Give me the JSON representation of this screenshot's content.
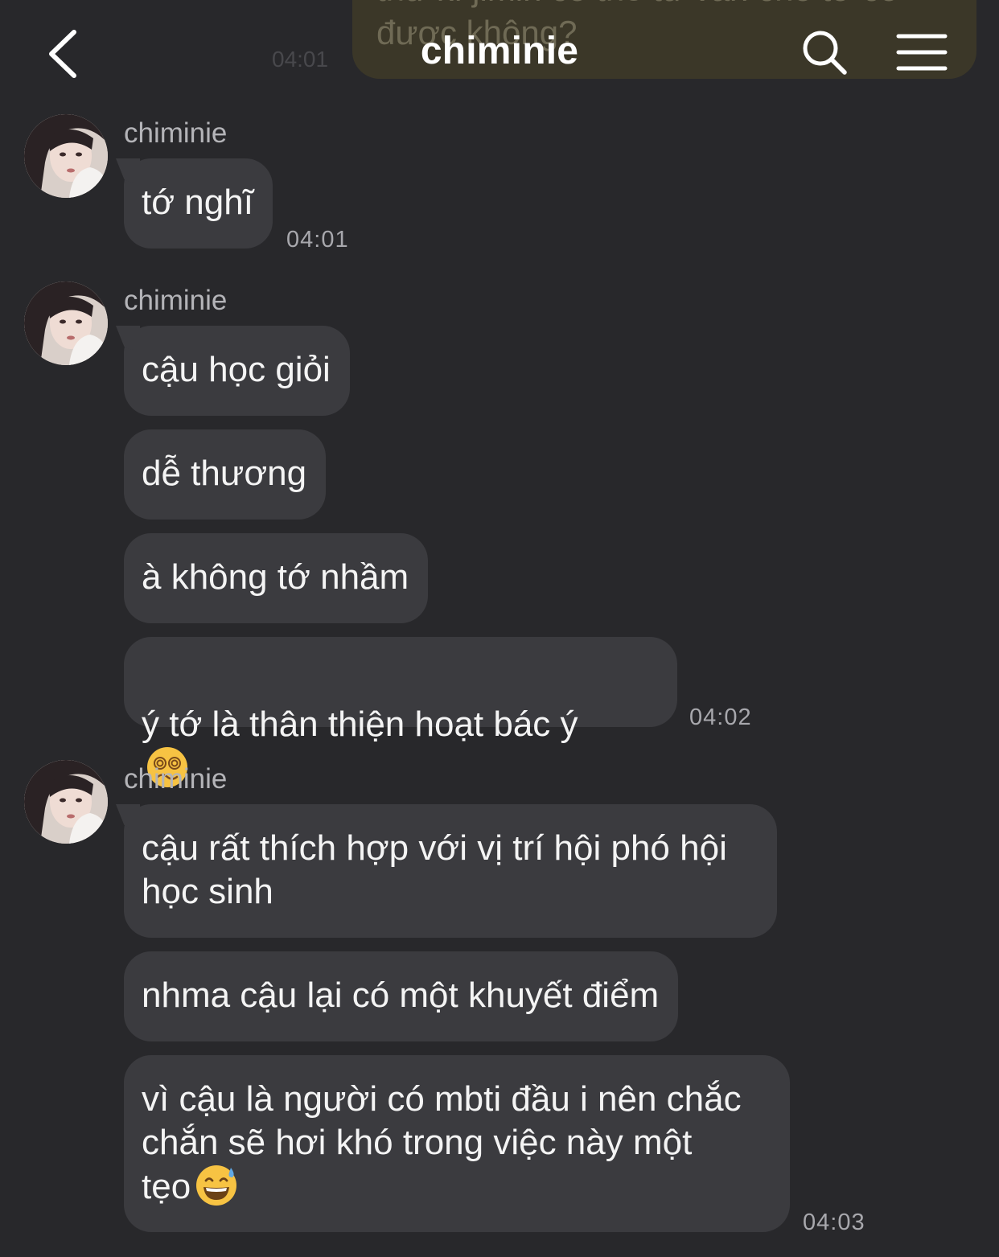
{
  "header": {
    "title": "chiminie",
    "ghost_text": "thứ kì jimin có thể tư vấn cho tớ có\nđược không?",
    "ghost_time": "04:01"
  },
  "groups": [
    {
      "sender": "chiminie",
      "messages": [
        "tớ nghĩ"
      ],
      "time": "04:01"
    },
    {
      "sender": "chiminie",
      "messages": [
        "cậu học giỏi",
        "dễ thương",
        "à không tớ nhầm",
        "ý tớ là thân thiện hoạt bác ý"
      ],
      "time": "04:02"
    },
    {
      "sender": "chiminie",
      "messages": [
        "cậu rất thích hợp với vị trí hội phó hội\nhọc sinh",
        "nhma cậu lại có một khuyết điểm",
        "vì cậu là người có mbti đầu i nên chắc\nchắn sẽ hơi khó trong việc này một\ntẹo"
      ],
      "time": "04:03"
    }
  ],
  "icons": {
    "back": "chevron-left-icon",
    "search": "search-icon",
    "menu": "hamburger-menu-icon",
    "dizzy_emoji": "dizzy-face-emoji",
    "sweat_emoji": "grinning-sweat-emoji"
  },
  "colors": {
    "background": "#28282b",
    "bubble": "#3b3b3f",
    "timestamp": "#a8a8ad"
  }
}
